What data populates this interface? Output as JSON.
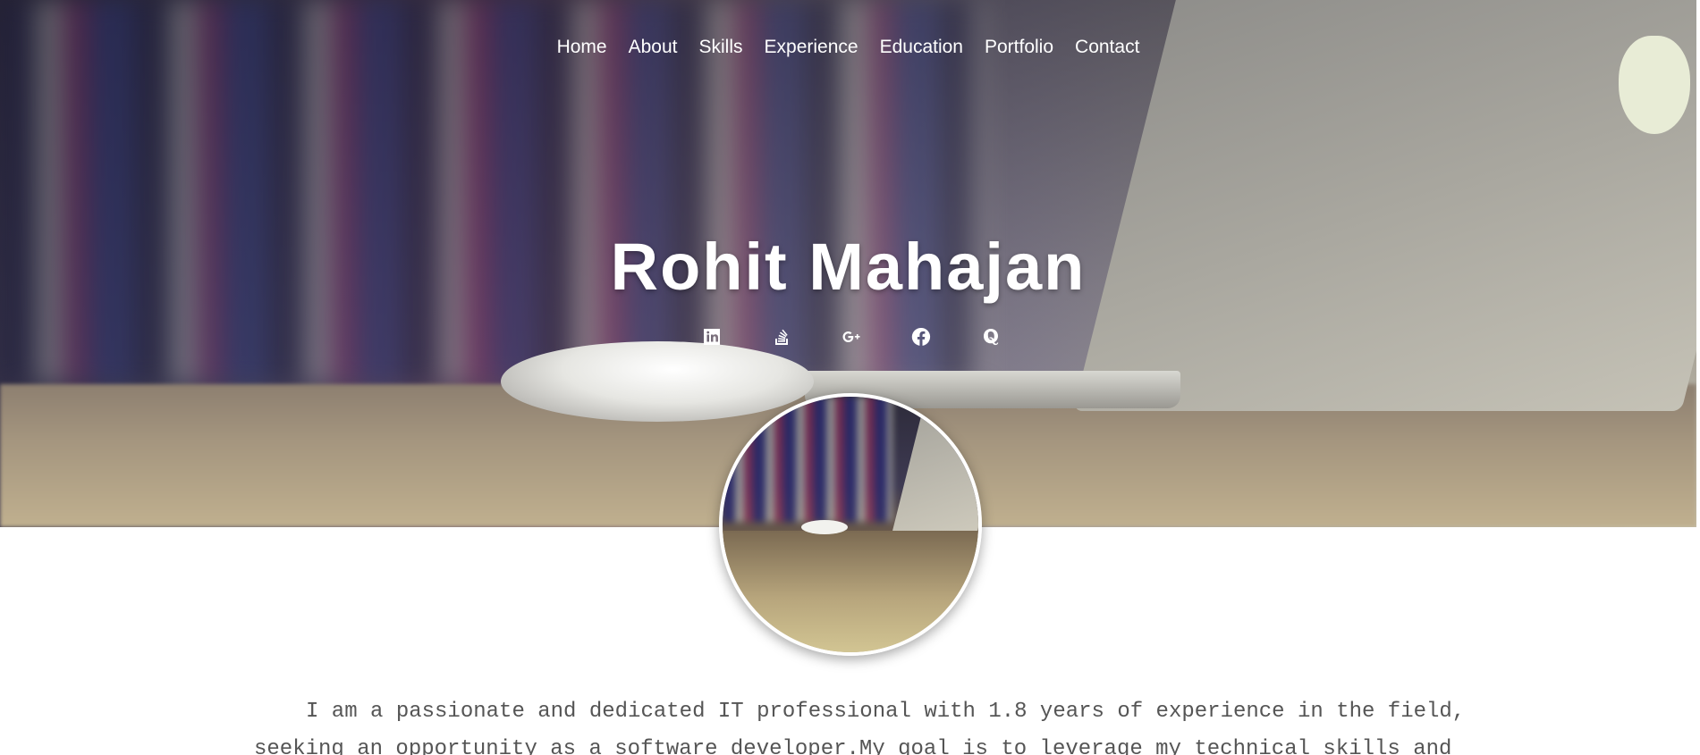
{
  "nav": {
    "items": [
      {
        "label": "Home"
      },
      {
        "label": "About"
      },
      {
        "label": "Skills"
      },
      {
        "label": "Experience"
      },
      {
        "label": "Education"
      },
      {
        "label": "Portfolio"
      },
      {
        "label": "Contact"
      }
    ]
  },
  "hero": {
    "name": "Rohit Mahajan"
  },
  "social": {
    "icons": [
      "linkedin-icon",
      "stackoverflow-icon",
      "google-plus-icon",
      "facebook-icon",
      "quora-icon"
    ]
  },
  "about": {
    "text": "I am a passionate and dedicated IT professional with 1.8 years of experience in the field, seeking an opportunity as a software developer.My goal is to leverage my technical skills and"
  },
  "colors": {
    "nav_text": "#ffffff",
    "name_text": "#ffffff",
    "body_text": "#555555"
  }
}
